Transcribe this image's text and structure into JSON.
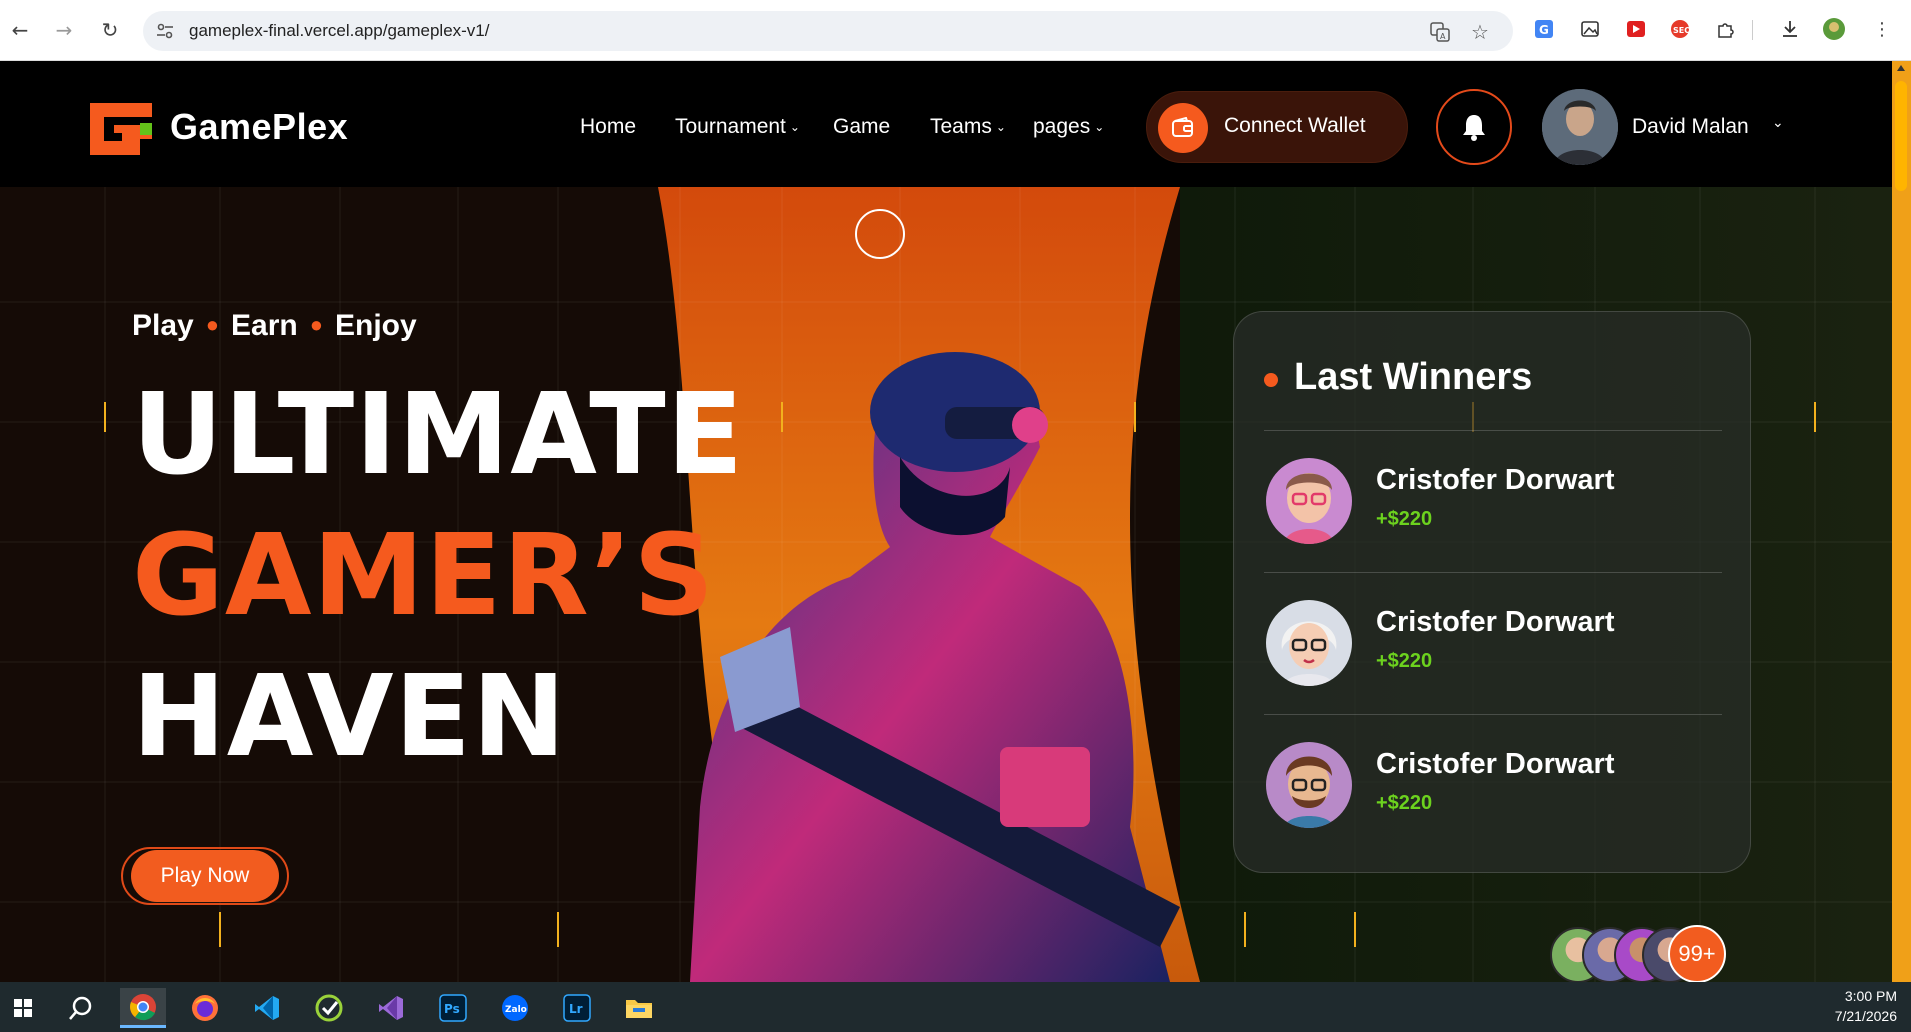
{
  "browser": {
    "url": "gameplex-final.vercel.app/gameplex-v1/"
  },
  "site": {
    "brand": "GamePlex",
    "nav": [
      {
        "label": "Home",
        "has_caret": false
      },
      {
        "label": "Tournament",
        "has_caret": true
      },
      {
        "label": "Game",
        "has_caret": false
      },
      {
        "label": "Teams",
        "has_caret": true
      },
      {
        "label": "pages",
        "has_caret": true
      }
    ],
    "connect_wallet": "Connect Wallet",
    "user_name": "David Malan",
    "accent": "#f55a1e"
  },
  "hero": {
    "tagline": [
      "Play",
      "Earn",
      "Enjoy"
    ],
    "title_lines": [
      {
        "text": "ULTIMATE",
        "color": "#ffffff"
      },
      {
        "text": "GAMER’S",
        "color": "#f55a1e"
      },
      {
        "text": "HAVEN",
        "color": "#ffffff"
      }
    ],
    "play_button": "Play Now"
  },
  "winners": {
    "title": "Last Winners",
    "items": [
      {
        "name": "Cristofer Dorwart",
        "amount": "+$220"
      },
      {
        "name": "Cristofer Dorwart",
        "amount": "+$220"
      },
      {
        "name": "Cristofer Dorwart",
        "amount": "+$220"
      }
    ],
    "amount_color": "#6cd21e"
  },
  "players": {
    "more_count": "99+"
  },
  "taskbar": {
    "time": "3:00 PM",
    "date": "7/21/2026"
  }
}
